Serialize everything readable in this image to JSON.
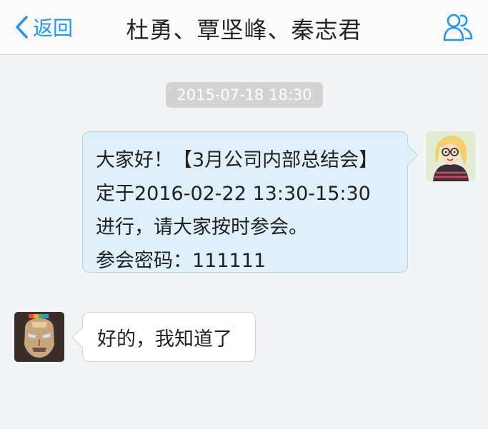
{
  "header": {
    "back_label": "返回",
    "title": "杜勇、覃坚峰、秦志君",
    "back_icon": "chevron-left-icon",
    "members_icon": "group-users-icon"
  },
  "timestamp": "2015-07-18 18:30",
  "messages": [
    {
      "direction": "outgoing",
      "avatar": "cartoon-girl-glasses",
      "lines": [
        "大家好！【3月公司内部总结会】",
        "定于2016-02-22 13:30-15:30",
        "进行，请大家按时参会。",
        "参会密码：111111"
      ]
    },
    {
      "direction": "incoming",
      "avatar": "iron-man-helmet",
      "text": "好的，我知道了"
    }
  ],
  "colors": {
    "accent": "#2196f3",
    "outgoing_bubble": "#dff0fb",
    "incoming_bubble": "#ffffff",
    "timestamp_bg": "#d3d3d3",
    "background": "#f3f4f6"
  }
}
